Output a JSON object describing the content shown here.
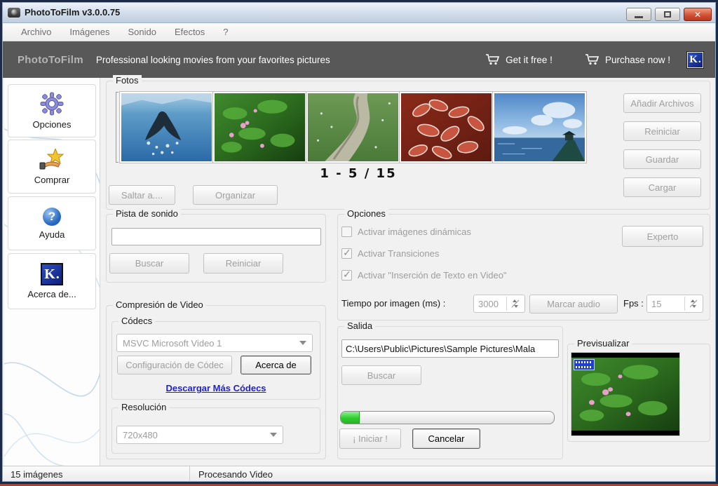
{
  "window": {
    "title": "PhotoToFilm v3.0.0.75"
  },
  "menu": {
    "items": [
      {
        "label": "Archivo"
      },
      {
        "label": "Imágenes"
      },
      {
        "label": "Sonido"
      },
      {
        "label": "Efectos"
      },
      {
        "label": "?"
      }
    ]
  },
  "banner": {
    "brand": "PhotoToFilm",
    "tagline": "Professional looking movies from your favorites pictures",
    "get_it_free": "Get it free !",
    "purchase_now": "Purchase now !"
  },
  "sidebar": {
    "items": [
      {
        "label": "Opciones",
        "icon": "gear-icon"
      },
      {
        "label": "Comprar",
        "icon": "hand-star-icon"
      },
      {
        "label": "Ayuda",
        "icon": "help-question-icon"
      },
      {
        "label": "Acerca de...",
        "icon": "kc-logo-icon"
      }
    ]
  },
  "fotos": {
    "title": "Fotos",
    "counter": "1 - 5 / 15",
    "thumbnails": [
      "whale-tail-ocean",
      "forest-flowers",
      "forest-path-meadow",
      "frosted-red-leaves",
      "dock-blue-sky"
    ],
    "saltar": "Saltar a....",
    "organizar": "Organizar",
    "anadir_archivos": "Añadir Archivos",
    "reiniciar": "Reiniciar",
    "guardar": "Guardar",
    "cargar": "Cargar"
  },
  "pista": {
    "title": "Pista de sonido",
    "input_value": "",
    "buscar": "Buscar",
    "reiniciar": "Reiniciar"
  },
  "opciones_group": {
    "title": "Opciones",
    "checkboxes": [
      {
        "label": "Activar imágenes dinámicas",
        "checked": false
      },
      {
        "label": "Activar Transiciones",
        "checked": true
      },
      {
        "label": "Activar \"Inserción de Texto en Video\"",
        "checked": true
      }
    ],
    "experto": "Experto",
    "tiempo_label": "Tiempo por imagen (ms) :",
    "tiempo_value": "3000",
    "marcar_audio": "Marcar audio",
    "fps_label": "Fps :",
    "fps_value": "15"
  },
  "compresion": {
    "title": "Compresión de Video",
    "codecs_title": "Códecs",
    "codec_selected": "MSVC Microsoft Video 1",
    "configuracion": "Configuración de Códec",
    "acerca_de": "Acerca de",
    "link": "Descargar Más Códecs",
    "resolucion_title": "Resolución",
    "resolucion_selected": "720x480"
  },
  "salida": {
    "title": "Salida",
    "path": "C:\\Users\\Public\\Pictures\\Sample Pictures\\Mala",
    "buscar": "Buscar",
    "progress_percent": 9,
    "iniciar": "¡ Iniciar !",
    "cancelar": "Cancelar"
  },
  "previsualizar": {
    "title": "Previsualizar"
  },
  "statusbar": {
    "images_count": "15 imágenes",
    "status_text": "Procesando Video"
  },
  "colors": {
    "banner_bg": "#585858",
    "link_blue": "#2222cc",
    "progress_green": "#2ecc2e",
    "close_red": "#c0392b"
  }
}
